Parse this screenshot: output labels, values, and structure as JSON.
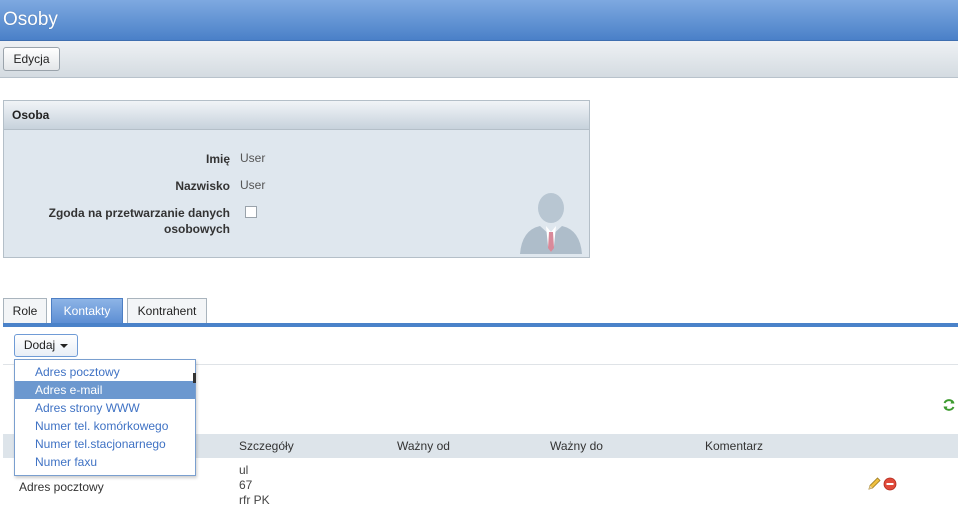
{
  "window": {
    "title": "Osoby"
  },
  "toolbar": {
    "edit_label": "Edycja"
  },
  "person_panel": {
    "header": "Osoba",
    "fields": [
      {
        "label": "Imię",
        "value": "User"
      },
      {
        "label": "Nazwisko",
        "value": "User"
      },
      {
        "label_line1": "Zgoda na przetwarzanie danych",
        "label_line2": "osobowych",
        "checked": false
      }
    ]
  },
  "tabs": [
    {
      "label": "Role",
      "active": false
    },
    {
      "label": "Kontakty",
      "active": true
    },
    {
      "label": "Kontrahent",
      "active": false
    }
  ],
  "contacts": {
    "add_label": "Dodaj",
    "add_menu": [
      {
        "label": "Adres pocztowy",
        "selected": false
      },
      {
        "label": "Adres e-mail",
        "selected": true
      },
      {
        "label": "Adres strony WWW",
        "selected": false
      },
      {
        "label": "Numer tel. komórkowego",
        "selected": false
      },
      {
        "label": "Numer tel.stacjonarnego",
        "selected": false
      },
      {
        "label": "Numer faxu",
        "selected": false
      }
    ],
    "columns": [
      "Szczegóły",
      "Ważny od",
      "Ważny do",
      "Komentarz"
    ],
    "rows": [
      {
        "type": "Adres pocztowy",
        "details": [
          "ul",
          "67",
          "rfr PK"
        ],
        "valid_from": "",
        "valid_to": "",
        "comment": ""
      }
    ]
  },
  "colors": {
    "accent": "#4a82c9",
    "header_blue": "#5b8dd3",
    "menu_link": "#3f72c4"
  },
  "icons": [
    "person-avatar-icon",
    "refresh-icon",
    "pencil-edit-icon",
    "delete-icon",
    "caret-down-icon"
  ]
}
